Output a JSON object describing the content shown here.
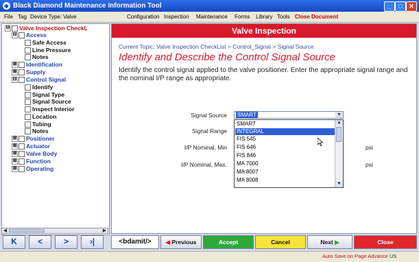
{
  "window": {
    "title": "Black Diamond Maintenance Information Tool",
    "app_icon_glyph": "◆",
    "controls": [
      "_",
      "□",
      "✕"
    ]
  },
  "menubar": {
    "items": [
      "File",
      "Tag",
      "Device Type:",
      "Valve",
      "Configuration",
      "Inspection",
      "Maintenance",
      "Forms",
      "Library",
      "Tools",
      "Close Document"
    ]
  },
  "tree": {
    "items": [
      {
        "label": "Valve Inspection CheckL",
        "toggle": "⊟",
        "color": "red"
      },
      {
        "label": "Access",
        "toggle": "⊟",
        "color": "blue"
      },
      {
        "label": "Safe Access",
        "toggle": "",
        "color": "black"
      },
      {
        "label": "Line Pressure",
        "toggle": "",
        "color": "black"
      },
      {
        "label": "Notes",
        "toggle": "",
        "color": "black"
      },
      {
        "label": "Identification",
        "toggle": "⊞",
        "color": "blue"
      },
      {
        "label": "Supply",
        "toggle": "⊞",
        "color": "blue"
      },
      {
        "label": "Control Signal",
        "toggle": "⊟",
        "color": "blue"
      },
      {
        "label": "Identify",
        "toggle": "",
        "color": "black"
      },
      {
        "label": "Signal Type",
        "toggle": "",
        "color": "black"
      },
      {
        "label": "Signal Source",
        "toggle": "",
        "color": "black"
      },
      {
        "label": "Inspect Interior",
        "toggle": "",
        "color": "black"
      },
      {
        "label": "Location",
        "toggle": "",
        "color": "black"
      },
      {
        "label": "Tubing",
        "toggle": "",
        "color": "black"
      },
      {
        "label": "Notes",
        "toggle": "",
        "color": "black"
      },
      {
        "label": "Positioner",
        "toggle": "⊞",
        "color": "blue"
      },
      {
        "label": "Actuator",
        "toggle": "⊞",
        "color": "blue"
      },
      {
        "label": "Valve Body",
        "toggle": "⊞",
        "color": "blue"
      },
      {
        "label": "Function",
        "toggle": "⊞",
        "color": "blue"
      },
      {
        "label": "Operating",
        "toggle": "⊞",
        "color": "blue"
      }
    ]
  },
  "nav_buttons": [
    "K",
    "<",
    ">",
    "›|"
  ],
  "panel": {
    "header": "Valve Inspection",
    "breadcrumb": "Current Topic: Valve Inspection CheckList > Control_Signal > Signal Source",
    "heading": "Identify and Describe the Control Signal Source",
    "instructions": "Identify the control signal applied to the valve positioner. Enter the appropriate signal range and the nominal I/P range as appropriate.",
    "fields": {
      "signal_source_label": "Signal Source",
      "signal_source_value": "SMART",
      "signal_range_label": "Signal Range",
      "ip_min_label": "I/P Nominal, Min",
      "ip_max_label": "I/P Nominal, Max.",
      "unit": "psi"
    },
    "dropdown_options": [
      "SMART",
      "INTEGRAL",
      "FIS 545",
      "FIS 646",
      "FIS 846",
      "MA 7000",
      "MA 8007",
      "MA 8008"
    ],
    "dropdown_selected_index": 1
  },
  "buttons": {
    "logo": "<bdamit/>",
    "previous": "Previous",
    "accept": "Accept",
    "cancel": "Cancel",
    "next": "Next",
    "close": "Close"
  },
  "status": {
    "autosave": "Auto Save on Page Advance",
    "locale": "US"
  },
  "colors": {
    "header_red": "#d8192b",
    "accept_green": "#2fa83a",
    "cancel_yellow": "#f5e43a",
    "close_red": "#e0262b",
    "selection_blue": "#2f5fd8"
  }
}
